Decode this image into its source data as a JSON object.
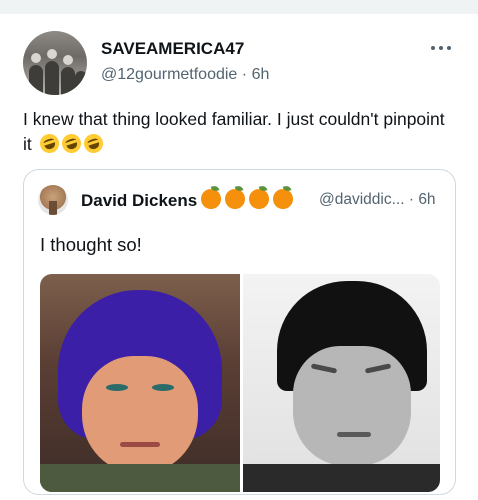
{
  "tweet": {
    "display_name": "SAVEAMERICA47",
    "handle": "@12gourmetfoodie",
    "time": "6h",
    "text": "I knew that thing looked familiar. I just couldn't pinpoint it",
    "emojis": [
      "rolling-on-floor-laughing",
      "rolling-on-floor-laughing",
      "rolling-on-floor-laughing"
    ]
  },
  "quote": {
    "display_name": "David Dickens",
    "name_emojis": [
      "tangerine",
      "tangerine",
      "tangerine",
      "tangerine"
    ],
    "handle": "@daviddic...",
    "time": "6h",
    "text": "I thought so!"
  },
  "colors": {
    "text_primary": "#0f1419",
    "text_secondary": "#536471",
    "border": "#cfd9de",
    "background": "#ffffff"
  }
}
